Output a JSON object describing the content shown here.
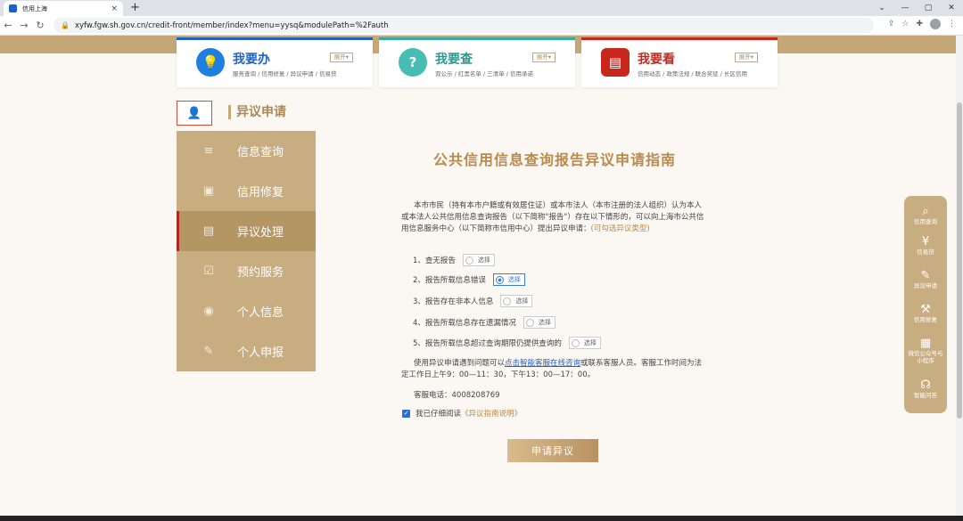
{
  "browser": {
    "tab_title": "信用上海",
    "tab_close": "×",
    "new_tab": "+",
    "url": "xyfw.fgw.sh.gov.cn/credit-front/member/index?menu=yysq&modulePath=%2Fauth",
    "window_controls": [
      "⌄",
      "—",
      "▢",
      "✕"
    ],
    "nav": {
      "back": "←",
      "forward": "→",
      "reload": "↻"
    },
    "tools": {
      "share": "⇪",
      "star": "☆",
      "ext": "✚",
      "menu": "⋮"
    }
  },
  "cards": [
    {
      "title": "我要办",
      "subtitle": "服务查询 / 信用修复 / 异议申请 / 信易贷",
      "expand": "展开▾",
      "color": "#1f63c6",
      "icon": "idea-icon",
      "glyph": "💡"
    },
    {
      "title": "我要查",
      "subtitle": "双公示 / 红黑名单 / 三清单 / 信用承诺",
      "expand": "展开▾",
      "color": "#3aa9a1",
      "icon": "question-icon",
      "glyph": "?"
    },
    {
      "title": "我要看",
      "subtitle": "信用动态 / 政策法规 / 联合奖惩 / 长区信用",
      "expand": "展开▾",
      "color": "#c8281c",
      "icon": "book-icon",
      "glyph": "▤"
    }
  ],
  "section": {
    "title": "异议申请"
  },
  "sidebar": {
    "items": [
      {
        "label": "信息查询",
        "icon": "≡"
      },
      {
        "label": "信用修复",
        "icon": "▣"
      },
      {
        "label": "异议处理",
        "icon": "▤"
      },
      {
        "label": "预约服务",
        "icon": "☑"
      },
      {
        "label": "个人信息",
        "icon": "◉"
      },
      {
        "label": "个人申报",
        "icon": "✎"
      }
    ]
  },
  "main": {
    "title": "公共信用信息查询报告异议申请指南",
    "intro": "本市市民（持有本市户籍或有效居住证）或本市法人（本市注册的法人组织）认为本人或本法人公共信用信息查询报告（以下简称\"报告\"）存在以下情形的，可以向上海市公共信用信息服务中心（以下简称市信用中心）提出异议申请：",
    "intro_hint": "(可勾选异议类型)",
    "choose_label": "选择",
    "options": [
      {
        "label": "1、查无报告",
        "selected": false
      },
      {
        "label": "2、报告所载信息错误",
        "selected": true
      },
      {
        "label": "3、报告存在非本人信息",
        "selected": false
      },
      {
        "label": "4、报告所载信息存在遗漏情况",
        "selected": false
      },
      {
        "label": "5、报告所载信息超过查询期限仍提供查询的",
        "selected": false
      }
    ],
    "help_pre": "使用异议申请遇到问题可以",
    "help_link": "点击智能客服在线咨询",
    "help_post": "或联系客服人员。客服工作时间为法定工作日上午9：00—11：30，下午13：00—17：00。",
    "phone": "客服电话：4008208769",
    "agree_pre": "我已仔细阅读",
    "agree_link": "《异议指南说明》",
    "submit": "申请异议"
  },
  "float_bar": [
    {
      "label": "信用查询",
      "icon": "search-doc-icon",
      "glyph": "⌕"
    },
    {
      "label": "信易贷",
      "icon": "loan-icon",
      "glyph": "¥"
    },
    {
      "label": "异议申请",
      "icon": "edit-doc-icon",
      "glyph": "✎"
    },
    {
      "label": "信用修复",
      "icon": "repair-icon",
      "glyph": "⚒"
    },
    {
      "label": "微信公众号与小程序",
      "icon": "qrcode-icon",
      "glyph": "▦"
    },
    {
      "label": "智能问答",
      "icon": "headset-icon",
      "glyph": "☊"
    }
  ]
}
